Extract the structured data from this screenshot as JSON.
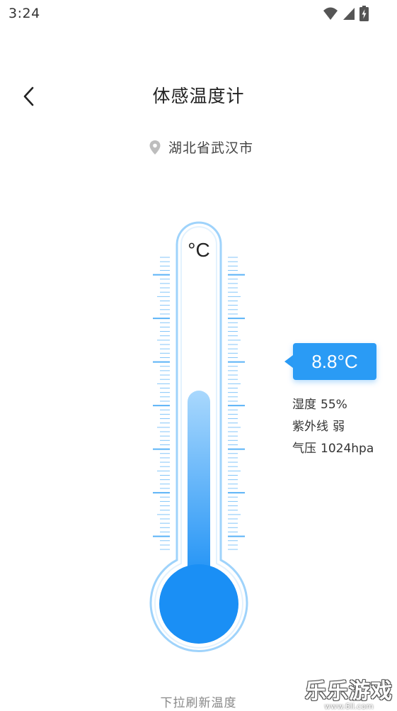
{
  "status_bar": {
    "time": "3:24",
    "icons": [
      "wifi-icon",
      "signal-icon",
      "battery-charging-icon"
    ]
  },
  "header": {
    "back_icon": "chevron-left-icon",
    "title": "体感温度计"
  },
  "location": {
    "icon": "location-pin-icon",
    "text": "湖北省武汉市"
  },
  "thermometer": {
    "unit_label": "°C",
    "level_fraction": 0.62,
    "colors": {
      "outline": "#9fd3fb",
      "fill_top": "#a9d8fd",
      "fill_bottom": "#1a8ff5",
      "scale": "#5bb3f7"
    }
  },
  "reading": {
    "temperature": "8.8°C",
    "humidity_label": "湿度",
    "humidity_value": "55%",
    "uv_label": "紫外线",
    "uv_value": "弱",
    "pressure_label": "气压",
    "pressure_value": "1024hpa"
  },
  "footer": {
    "pull_hint": "下拉刷新温度"
  },
  "watermark": {
    "logo": "乐乐游戏",
    "url": "www.6ll.com"
  }
}
